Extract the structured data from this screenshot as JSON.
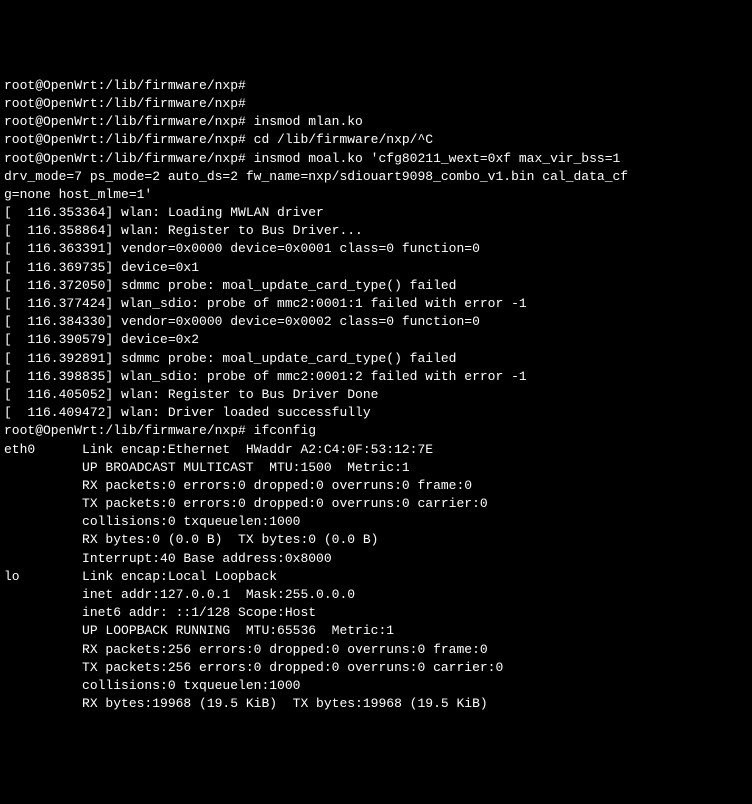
{
  "prompt": "root@OpenWrt:/lib/firmware/nxp#",
  "lines": [
    {
      "type": "prompt",
      "cmd": ""
    },
    {
      "type": "prompt",
      "cmd": ""
    },
    {
      "type": "prompt",
      "cmd": "insmod mlan.ko"
    },
    {
      "type": "prompt",
      "cmd": "cd /lib/firmware/nxp/^C"
    },
    {
      "type": "prompt",
      "cmd": "insmod moal.ko 'cfg80211_wext=0xf max_vir_bss=1"
    },
    {
      "type": "cont",
      "text": "drv_mode=7 ps_mode=2 auto_ds=2 fw_name=nxp/sdiouart9098_combo_v1.bin cal_data_cf"
    },
    {
      "type": "cont",
      "text": "g=none host_mlme=1'"
    },
    {
      "type": "kmsg",
      "ts": "116.353364",
      "msg": "wlan: Loading MWLAN driver"
    },
    {
      "type": "kmsg",
      "ts": "116.358864",
      "msg": "wlan: Register to Bus Driver..."
    },
    {
      "type": "kmsg",
      "ts": "116.363391",
      "msg": "vendor=0x0000 device=0x0001 class=0 function=0"
    },
    {
      "type": "kmsg",
      "ts": "116.369735",
      "msg": "device=0x1"
    },
    {
      "type": "kmsg",
      "ts": "116.372050",
      "msg": "sdmmc probe: moal_update_card_type() failed"
    },
    {
      "type": "kmsg",
      "ts": "116.377424",
      "msg": "wlan_sdio: probe of mmc2:0001:1 failed with error -1"
    },
    {
      "type": "kmsg",
      "ts": "116.384330",
      "msg": "vendor=0x0000 device=0x0002 class=0 function=0"
    },
    {
      "type": "kmsg",
      "ts": "116.390579",
      "msg": "device=0x2"
    },
    {
      "type": "kmsg",
      "ts": "116.392891",
      "msg": "sdmmc probe: moal_update_card_type() failed"
    },
    {
      "type": "kmsg",
      "ts": "116.398835",
      "msg": "wlan_sdio: probe of mmc2:0001:2 failed with error -1"
    },
    {
      "type": "kmsg",
      "ts": "116.405052",
      "msg": "wlan: Register to Bus Driver Done"
    },
    {
      "type": "kmsg",
      "ts": "116.409472",
      "msg": "wlan: Driver loaded successfully"
    },
    {
      "type": "prompt",
      "cmd": "ifconfig"
    },
    {
      "type": "out",
      "text": "eth0      Link encap:Ethernet  HWaddr A2:C4:0F:53:12:7E"
    },
    {
      "type": "out",
      "text": "          UP BROADCAST MULTICAST  MTU:1500  Metric:1"
    },
    {
      "type": "out",
      "text": "          RX packets:0 errors:0 dropped:0 overruns:0 frame:0"
    },
    {
      "type": "out",
      "text": "          TX packets:0 errors:0 dropped:0 overruns:0 carrier:0"
    },
    {
      "type": "out",
      "text": "          collisions:0 txqueuelen:1000"
    },
    {
      "type": "out",
      "text": "          RX bytes:0 (0.0 B)  TX bytes:0 (0.0 B)"
    },
    {
      "type": "out",
      "text": "          Interrupt:40 Base address:0x8000"
    },
    {
      "type": "out",
      "text": ""
    },
    {
      "type": "out",
      "text": "lo        Link encap:Local Loopback"
    },
    {
      "type": "out",
      "text": "          inet addr:127.0.0.1  Mask:255.0.0.0"
    },
    {
      "type": "out",
      "text": "          inet6 addr: ::1/128 Scope:Host"
    },
    {
      "type": "out",
      "text": "          UP LOOPBACK RUNNING  MTU:65536  Metric:1"
    },
    {
      "type": "out",
      "text": "          RX packets:256 errors:0 dropped:0 overruns:0 frame:0"
    },
    {
      "type": "out",
      "text": "          TX packets:256 errors:0 dropped:0 overruns:0 carrier:0"
    },
    {
      "type": "out",
      "text": "          collisions:0 txqueuelen:1000"
    },
    {
      "type": "out",
      "text": "          RX bytes:19968 (19.5 KiB)  TX bytes:19968 (19.5 KiB)"
    },
    {
      "type": "out",
      "text": ""
    }
  ]
}
